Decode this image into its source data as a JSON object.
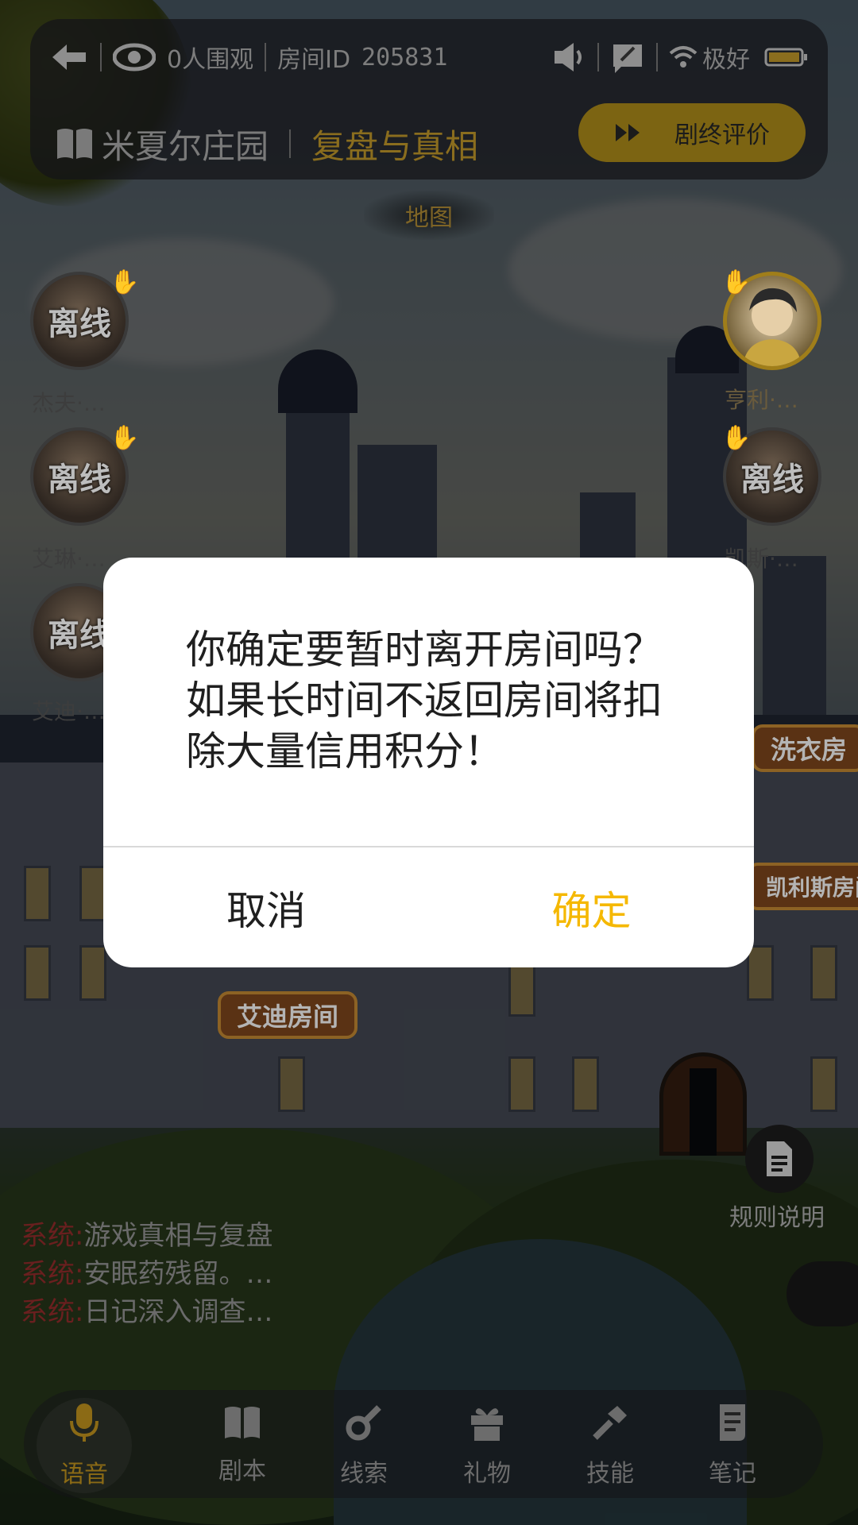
{
  "topbar": {
    "viewers": "0人围观",
    "room_id_label": "房间ID",
    "room_id": "205831",
    "signal": "极好",
    "script_name": "米夏尔庄园",
    "chapter": "复盘与真相",
    "review_button": "剧终评价"
  },
  "map_label": "地图",
  "players": [
    {
      "name": "杰夫·…",
      "status": "离线"
    },
    {
      "name": "艾琳·…",
      "status": "离线"
    },
    {
      "name": "艾迪·…",
      "status": "离线"
    },
    {
      "name": "亨利·…",
      "status": "online"
    },
    {
      "name": "凯斯·…",
      "status": "离线"
    }
  ],
  "rooms": {
    "laundry": "洗衣房",
    "kais_room": "凯利斯房间",
    "eddie_room": "艾迪房间"
  },
  "rules_label": "规则说明",
  "system_messages": [
    {
      "tag": "系统:",
      "text": "游戏真相与复盘"
    },
    {
      "tag": "系统:",
      "text": "安眠药残留。…"
    },
    {
      "tag": "系统:",
      "text": "日记深入调查…"
    }
  ],
  "nav": [
    {
      "label": "语音",
      "icon": "microphone-icon",
      "active": true
    },
    {
      "label": "剧本",
      "icon": "book-icon"
    },
    {
      "label": "线索",
      "icon": "magnifier-icon"
    },
    {
      "label": "礼物",
      "icon": "gift-icon"
    },
    {
      "label": "技能",
      "icon": "hammer-icon"
    },
    {
      "label": "笔记",
      "icon": "notes-icon"
    }
  ],
  "modal": {
    "message": "你确定要暂时离开房间吗？如果长时间不返回房间将扣除大量信用积分！",
    "cancel": "取消",
    "confirm": "确定"
  },
  "colors": {
    "accent": "#f5b800",
    "overlay": "rgba(0,0,0,0.66)"
  }
}
